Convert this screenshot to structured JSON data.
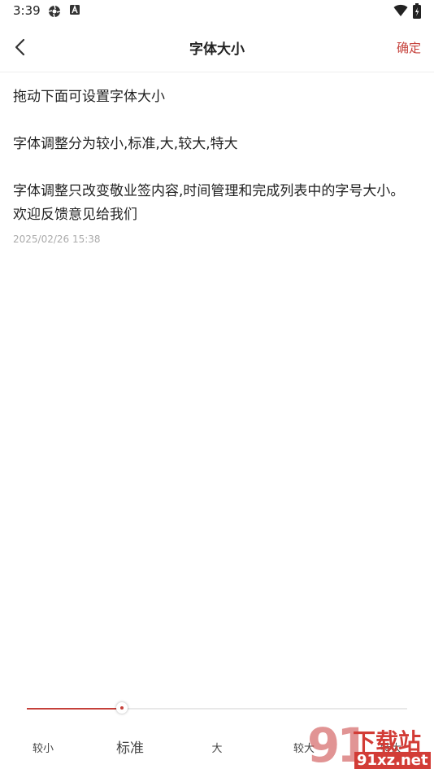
{
  "status_bar": {
    "time": "3:39",
    "icons": [
      "gear-icon",
      "a-box-icon",
      "wifi-icon",
      "battery-icon"
    ]
  },
  "nav": {
    "title": "字体大小",
    "confirm_label": "确定",
    "back_icon": "chevron-left-icon"
  },
  "content": {
    "paragraphs": [
      "拖动下面可设置字体大小",
      "字体调整分为较小,标准,大,较大,特大",
      "字体调整只改变敬业签内容,时间管理和完成列表中的字号大小。欢迎反馈意见给我们"
    ],
    "timestamp": "2025/02/26 15:38"
  },
  "font_slider": {
    "options": [
      "较小",
      "标准",
      "大",
      "较大",
      "特大"
    ],
    "selected": "标准",
    "position_fraction": 0.25
  },
  "watermark": {
    "number": "91",
    "top_text": "下载站",
    "bottom_text": "91xz.net"
  },
  "colors": {
    "accent": "#c5403a",
    "track": "#e8e8e8",
    "text": "#222222",
    "muted": "#aaaaaa"
  }
}
